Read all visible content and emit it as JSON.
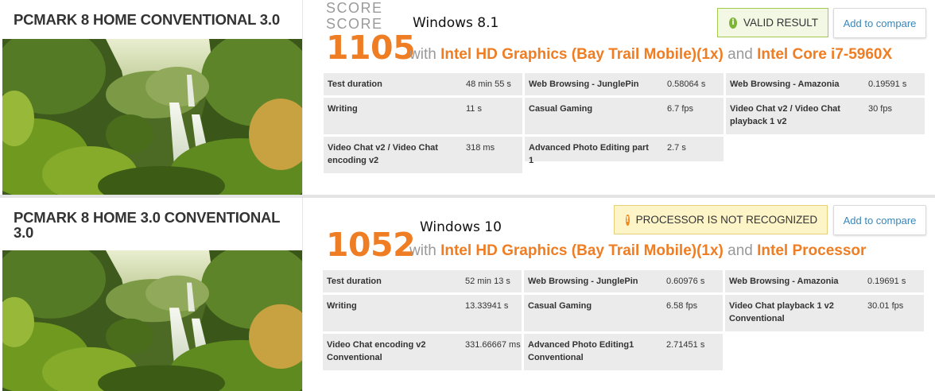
{
  "panels": [
    {
      "title": "PCMARK 8 HOME CONVENTIONAL 3.0",
      "score_label": "SCORE",
      "score": "1105",
      "os_label": "Windows 8.1",
      "with_text": "with",
      "gpu": "Intel HD Graphics (Bay Trail Mobile)(1x)",
      "and_text": "and",
      "cpu": "Intel Core i7-5960X",
      "badge": {
        "type": "valid",
        "icon": "info-icon",
        "text": "VALID RESULT"
      },
      "compare_label": "Add to compare",
      "rows": [
        [
          {
            "label": "Test duration",
            "value": "48 min 55 s"
          },
          {
            "label": "Web Browsing - JunglePin",
            "value": "0.58064 s"
          },
          {
            "label": "Web Browsing - Amazonia",
            "value": "0.19591 s"
          }
        ],
        [
          {
            "label": "Writing",
            "value": "11 s"
          },
          {
            "label": "Casual Gaming",
            "value": "6.7 fps"
          },
          {
            "label": "Video Chat v2 / Video Chat playback 1 v2",
            "value": "30 fps"
          }
        ],
        [
          {
            "label": "Video Chat v2 / Video Chat encoding v2",
            "value": "318 ms"
          },
          {
            "label": "Advanced Photo Editing part 1",
            "value": "2.7 s"
          }
        ]
      ]
    },
    {
      "title": "PCMARK 8 HOME 3.0 CONVENTIONAL 3.0",
      "score_label": "SCORE",
      "score": "1052",
      "os_label": "Windows 10",
      "with_text": "with",
      "gpu": "Intel HD Graphics (Bay Trail Mobile)(1x)",
      "and_text": "and",
      "cpu": "Intel Processor",
      "badge": {
        "type": "warning",
        "icon": "warning-icon",
        "text": "PROCESSOR IS NOT RECOGNIZED"
      },
      "compare_label": "Add to compare",
      "rows": [
        [
          {
            "label": "Test duration",
            "value": "52 min 13 s"
          },
          {
            "label": "Web Browsing - JunglePin",
            "value": "0.60976 s"
          },
          {
            "label": "Web Browsing - Amazonia",
            "value": "0.19691 s"
          }
        ],
        [
          {
            "label": "Writing",
            "value": "13.33941 s"
          },
          {
            "label": "Casual Gaming",
            "value": "6.58 fps"
          },
          {
            "label": "Video Chat playback 1 v2 Conventional",
            "value": "30.01 fps"
          }
        ],
        [
          {
            "label": "Video Chat encoding v2 Conventional",
            "value": "331.66667 ms"
          },
          {
            "label": "Advanced Photo Editing1 Conventional",
            "value": "2.71451 s"
          }
        ]
      ]
    }
  ],
  "colors": {
    "accent": "#ef7d23",
    "link": "#3a86b6",
    "valid_border": "#a2cb4e",
    "warning_bg": "#fdf5c8",
    "cell_bg": "#ebebeb"
  }
}
